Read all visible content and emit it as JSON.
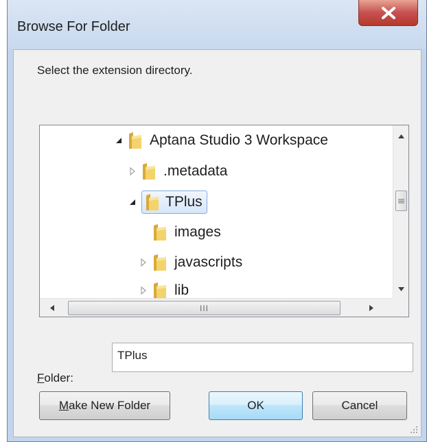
{
  "dialog": {
    "title": "Browse For Folder",
    "prompt": "Select the extension directory."
  },
  "tree": {
    "items": [
      {
        "label": "Aptana Studio 3 Workspace",
        "expanded": true,
        "has_children": true
      },
      {
        "label": ".metadata",
        "expanded": false,
        "has_children": true
      },
      {
        "label": "TPlus",
        "expanded": true,
        "has_children": true,
        "selected": true
      },
      {
        "label": "images",
        "expanded": false,
        "has_children": false
      },
      {
        "label": "javascripts",
        "expanded": false,
        "has_children": true
      },
      {
        "label": "lib",
        "expanded": false,
        "has_children": true
      }
    ],
    "hscroll_grip": "III"
  },
  "folder": {
    "label_first": "F",
    "label_rest": "older:",
    "value": "TPlus"
  },
  "buttons": {
    "make_new_first": "M",
    "make_new_rest": "ake New Folder",
    "ok": "OK",
    "cancel": "Cancel"
  },
  "colors": {
    "selection_border": "#84acdd",
    "close_button": "#c75050",
    "folder_yellow": "#e8c24a"
  },
  "icons": [
    "close-icon",
    "folder-icon",
    "expand-arrow-icon",
    "collapse-arrow-icon",
    "scroll-up-icon",
    "scroll-down-icon",
    "scroll-left-icon",
    "scroll-right-icon"
  ]
}
